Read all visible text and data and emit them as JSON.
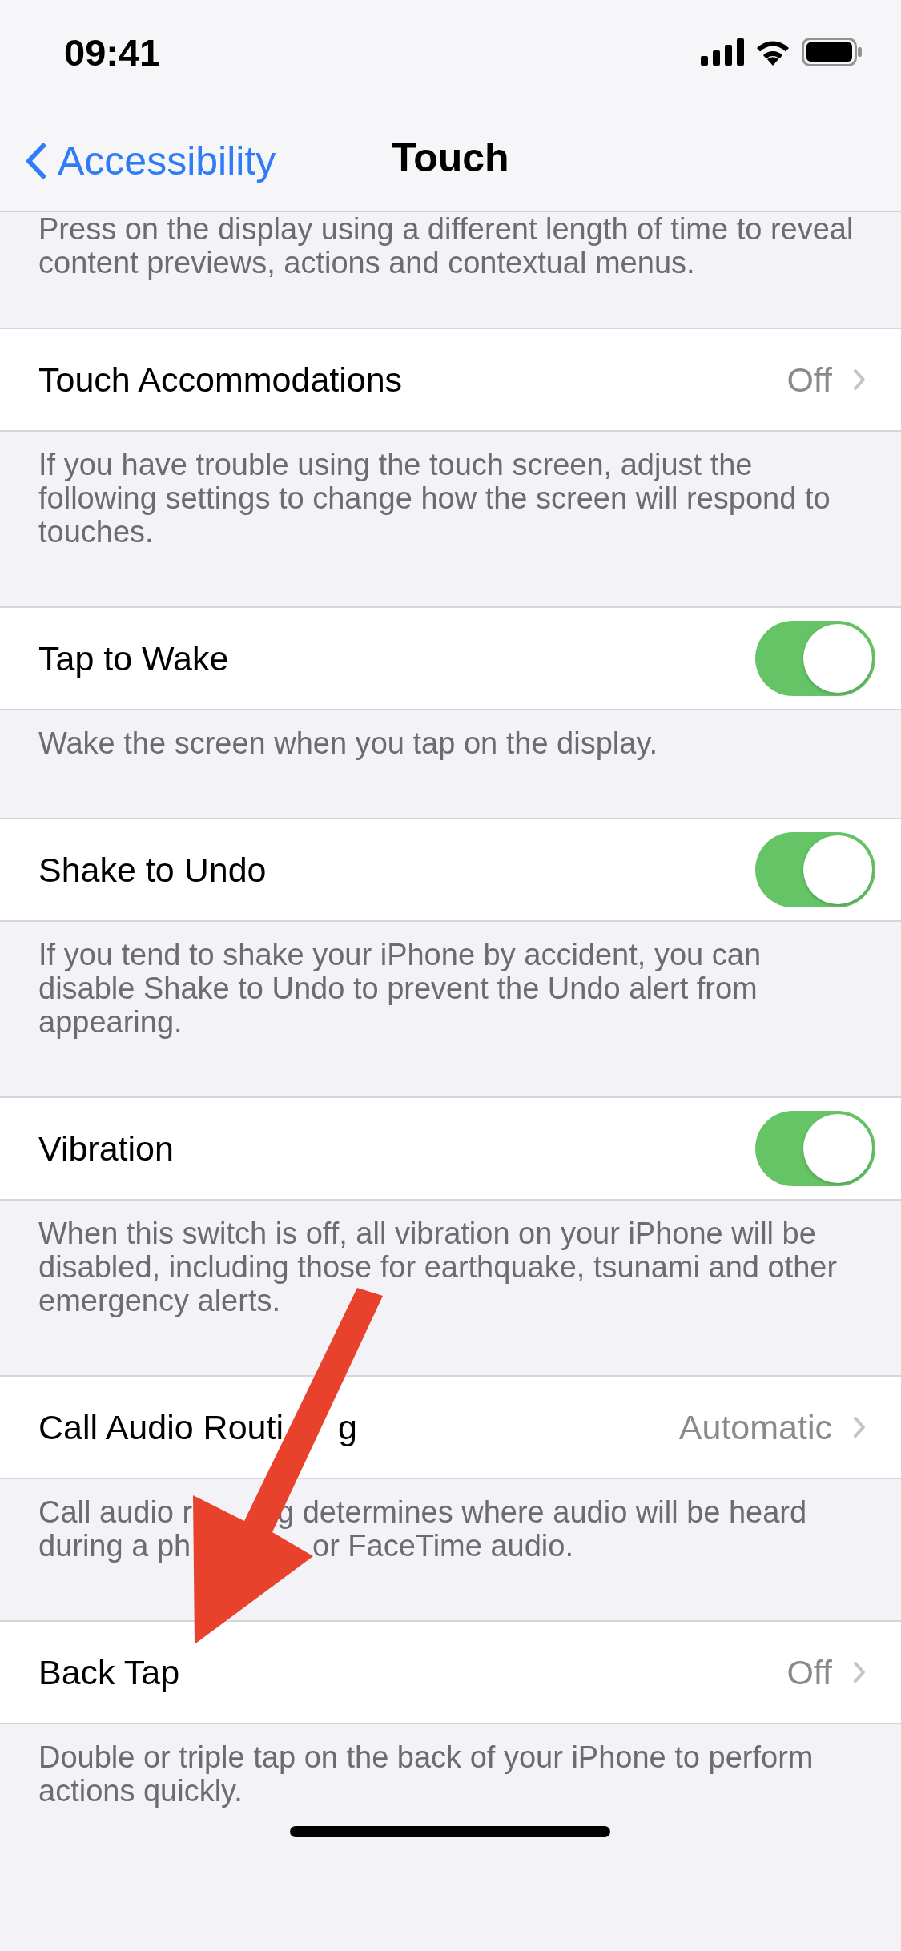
{
  "status_bar": {
    "time": "09:41"
  },
  "nav_bar": {
    "back": "Accessibility",
    "title": "Touch"
  },
  "top_note": "Press on the display using a different length of time to reveal content previews, actions and contextual menus.",
  "sections": [
    {
      "row": {
        "kind": "detail",
        "label": "Touch Accommodations",
        "value": "Off"
      },
      "footer": "If you have trouble using the touch screen, adjust the following settings to change how the screen will respond to touches."
    },
    {
      "row": {
        "kind": "toggle",
        "label": "Tap to Wake",
        "on": true
      },
      "footer": "Wake the screen when you tap on the display."
    },
    {
      "row": {
        "kind": "toggle",
        "label": "Shake to Undo",
        "on": true
      },
      "footer": "If you tend to shake your iPhone by accident, you can disable Shake to Undo to prevent the Undo alert from appearing."
    },
    {
      "row": {
        "kind": "toggle",
        "label": "Vibration",
        "on": true
      },
      "footer": "When this switch is off, all vibration on your iPhone will be disabled, including those for earthquake, tsunami and other emergency alerts."
    },
    {
      "row": {
        "kind": "detail",
        "label_parts": [
          "Call Audio Routi",
          "g"
        ],
        "value": "Automatic"
      },
      "footer_lines": [
        [
          "Call audio r",
          "g determines where audio will be heard"
        ],
        [
          "during a ph",
          "or FaceTime audio."
        ]
      ]
    },
    {
      "row": {
        "kind": "detail",
        "label": "Back Tap",
        "value": "Off"
      },
      "footer": "Double or triple tap on the back of your iPhone to perform actions quickly."
    }
  ]
}
